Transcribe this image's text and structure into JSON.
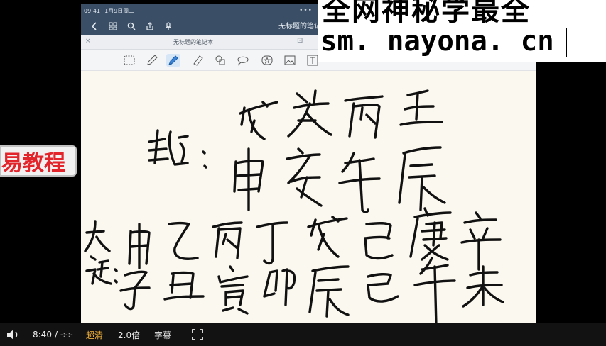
{
  "side_banner": {
    "text": "易教程"
  },
  "status_bar": {
    "time": "09:41",
    "date": "1月9日周二",
    "dots": "•••"
  },
  "nav_bar": {
    "title": "无标题的笔记"
  },
  "tab_strip": {
    "close": "×",
    "title": "无标题的笔记本",
    "extra": "⊡"
  },
  "watermark": {
    "top": "全网神秘学最全",
    "bottom": "sm. nayona. cn"
  },
  "player": {
    "current_time": "8:40",
    "separator": "/",
    "duration": "-:-:-",
    "quality": "超清",
    "speed": "2.0倍",
    "subtitles": "字幕"
  },
  "colors": {
    "ink": "#111111",
    "nav_bg": "#3a4e66",
    "paper": "#fbf8ef",
    "accent": "#f4b33d",
    "banner_red": "#e3242b"
  }
}
